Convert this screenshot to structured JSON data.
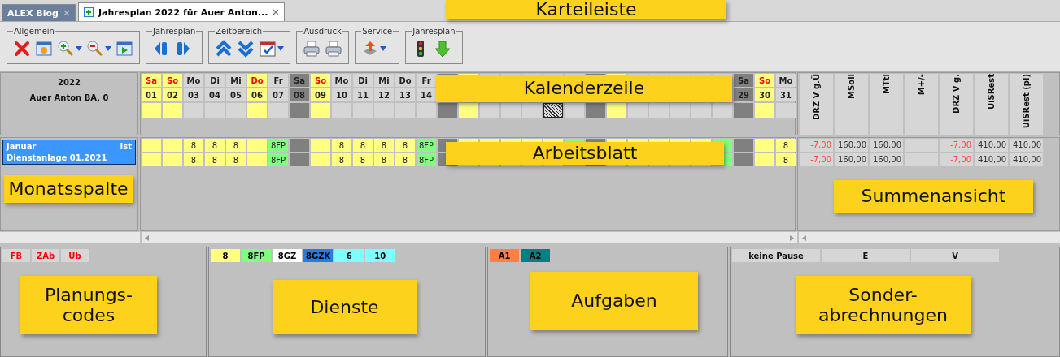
{
  "tabs": [
    {
      "label": "ALEX Blog",
      "selected": false
    },
    {
      "label": "Jahresplan 2022 für Auer Anton...",
      "selected": true
    }
  ],
  "toolbar": [
    {
      "label": "Allgemein",
      "tools": [
        {
          "kind": "delete"
        },
        {
          "kind": "calendar"
        },
        {
          "kind": "zoom-in",
          "menu": true
        },
        {
          "kind": "zoom-out",
          "menu": true
        },
        {
          "kind": "play"
        }
      ]
    },
    {
      "label": "Jahresplan",
      "tools": [
        {
          "kind": "previous"
        },
        {
          "kind": "next"
        }
      ]
    },
    {
      "label": "Zeitbereich",
      "tools": [
        {
          "kind": "up"
        },
        {
          "kind": "down"
        },
        {
          "kind": "date",
          "menu": true
        }
      ]
    },
    {
      "label": "Ausdruck",
      "tools": [
        {
          "kind": "printer"
        },
        {
          "kind": "printer"
        }
      ]
    },
    {
      "label": "Service",
      "tools": [
        {
          "kind": "export",
          "menu": true
        }
      ]
    },
    {
      "label": "Jahresplan",
      "tools": [
        {
          "kind": "traffic-light"
        },
        {
          "kind": "download"
        }
      ]
    }
  ],
  "person": {
    "year": "2022",
    "name": "Auer Anton BA, 0"
  },
  "months": [
    {
      "month": "Januar",
      "type": "Ist",
      "plan": "Dienstanlage 01.2021",
      "selected": true
    }
  ],
  "days": [
    {
      "weekday": "Sa",
      "date": "01",
      "kind": "free"
    },
    {
      "weekday": "So",
      "date": "02",
      "kind": "free"
    },
    {
      "weekday": "Mo",
      "date": "03",
      "kind": "work"
    },
    {
      "weekday": "Di",
      "date": "04",
      "kind": "work"
    },
    {
      "weekday": "Mi",
      "date": "05",
      "kind": "work"
    },
    {
      "weekday": "Do",
      "date": "06",
      "kind": "free"
    },
    {
      "weekday": "Fr",
      "date": "07",
      "kind": "work"
    },
    {
      "weekday": "Sa",
      "date": "08",
      "kind": "sat"
    },
    {
      "weekday": "So",
      "date": "09",
      "kind": "free"
    },
    {
      "weekday": "Mo",
      "date": "10",
      "kind": "work"
    },
    {
      "weekday": "Di",
      "date": "11",
      "kind": "work"
    },
    {
      "weekday": "Mi",
      "date": "12",
      "kind": "work"
    },
    {
      "weekday": "Do",
      "date": "13",
      "kind": "work"
    },
    {
      "weekday": "Fr",
      "date": "14",
      "kind": "work"
    },
    {
      "kind": "sat"
    },
    {
      "kind": "free"
    },
    {
      "kind": "work"
    },
    {
      "kind": "work"
    },
    {
      "kind": "work"
    },
    {
      "kind": "marked"
    },
    {
      "kind": "work"
    },
    {
      "kind": "sat"
    },
    {
      "kind": "free"
    },
    {
      "kind": "work"
    },
    {
      "kind": "work"
    },
    {
      "kind": "work"
    },
    {
      "kind": "work"
    },
    {
      "kind": "work"
    },
    {
      "weekday": "Sa",
      "date": "29",
      "kind": "sat"
    },
    {
      "weekday": "So",
      "date": "30",
      "kind": "free"
    },
    {
      "weekday": "Mo",
      "date": "31",
      "kind": "work"
    }
  ],
  "plan_rows": [
    [
      {
        "kind": "free"
      },
      {
        "kind": "free"
      },
      {
        "kind": "duty",
        "value": "8"
      },
      {
        "kind": "duty",
        "value": "8"
      },
      {
        "kind": "duty",
        "value": "8"
      },
      {
        "kind": "free"
      },
      {
        "kind": "fp",
        "value": "8FP"
      },
      {
        "kind": "sat"
      },
      {
        "kind": "free"
      },
      {
        "kind": "duty",
        "value": "8"
      },
      {
        "kind": "duty",
        "value": "8"
      },
      {
        "kind": "duty",
        "value": "8"
      },
      {
        "kind": "duty",
        "value": "8"
      },
      {
        "kind": "fp",
        "value": "8FP"
      },
      {
        "kind": "sat"
      },
      {
        "kind": "free"
      },
      {
        "kind": "duty"
      },
      {
        "kind": "duty"
      },
      {
        "kind": "duty"
      },
      {
        "kind": "duty"
      },
      {
        "kind": "fp"
      },
      {
        "kind": "sat"
      },
      {
        "kind": "free"
      },
      {
        "kind": "duty"
      },
      {
        "kind": "duty"
      },
      {
        "kind": "duty"
      },
      {
        "kind": "duty"
      },
      {
        "kind": "fp"
      },
      {
        "kind": "sat"
      },
      {
        "kind": "free"
      },
      {
        "kind": "duty",
        "value": "8"
      }
    ],
    [
      {
        "kind": "free"
      },
      {
        "kind": "free"
      },
      {
        "kind": "duty",
        "value": "8"
      },
      {
        "kind": "duty",
        "value": "8"
      },
      {
        "kind": "duty",
        "value": "8"
      },
      {
        "kind": "free"
      },
      {
        "kind": "fp",
        "value": "8FP"
      },
      {
        "kind": "sat"
      },
      {
        "kind": "free"
      },
      {
        "kind": "duty",
        "value": "8"
      },
      {
        "kind": "duty",
        "value": "8"
      },
      {
        "kind": "duty",
        "value": "8"
      },
      {
        "kind": "duty",
        "value": "8"
      },
      {
        "kind": "fp",
        "value": "8FP"
      },
      {
        "kind": "sat"
      },
      {
        "kind": "free"
      },
      {
        "kind": "duty"
      },
      {
        "kind": "duty"
      },
      {
        "kind": "duty"
      },
      {
        "kind": "duty"
      },
      {
        "kind": "fp"
      },
      {
        "kind": "sat"
      },
      {
        "kind": "free"
      },
      {
        "kind": "duty"
      },
      {
        "kind": "duty"
      },
      {
        "kind": "duty"
      },
      {
        "kind": "duty"
      },
      {
        "kind": "fp"
      },
      {
        "kind": "sat"
      },
      {
        "kind": "free"
      },
      {
        "kind": "duty",
        "value": "8"
      }
    ]
  ],
  "sums": {
    "columns": [
      "DRZ V g.Ü",
      "MSoll",
      "MTtl",
      "M+/-",
      "DRZ V g.",
      "UiSRest",
      "UiSRest (pl)"
    ],
    "rows": [
      [
        {
          "value": "-7,00",
          "negative": true
        },
        {
          "value": "160,00",
          "negative": false
        },
        {
          "value": "160,00",
          "negative": false
        },
        {},
        {
          "value": "-7,00",
          "negative": true
        },
        {
          "value": "410,00",
          "negative": false
        },
        {
          "value": "410,00",
          "negative": false
        }
      ],
      [
        {
          "value": "-7,00",
          "negative": true
        },
        {
          "value": "160,00",
          "negative": false
        },
        {
          "value": "160,00",
          "negative": false
        },
        {},
        {
          "value": "-7,00",
          "negative": true
        },
        {
          "value": "410,00",
          "negative": false
        },
        {
          "value": "410,00",
          "negative": false
        }
      ]
    ]
  },
  "planning_codes": [
    "FB",
    "ZAb",
    "Ub"
  ],
  "services": [
    {
      "label": "8",
      "color": "#ffff80"
    },
    {
      "label": "8FP",
      "color": "#80ff80"
    },
    {
      "label": "8GZ",
      "color": "#ffffff"
    },
    {
      "label": "8GZK",
      "color": "#1e7fe8"
    },
    {
      "label": "6",
      "color": "#80ffff"
    },
    {
      "label": "10",
      "color": "#80ffff"
    }
  ],
  "tasks": [
    {
      "label": "A1",
      "color": "#ff8040"
    },
    {
      "label": "A2",
      "color": "#008080"
    }
  ],
  "special_accounts": [
    "keine Pause",
    "E",
    "V"
  ],
  "callouts": {
    "tab_bar": "Karteileiste",
    "calendar_row": "Kalenderzeile",
    "worksheet": "Arbeitsblatt",
    "month_column": "Monatsspalte",
    "sums_view": "Summenansicht",
    "planning_codes": "Planungs-codes",
    "services": "Dienste",
    "tasks": "Aufgaben",
    "special_accounts": "Sonder-abrechnungen"
  }
}
